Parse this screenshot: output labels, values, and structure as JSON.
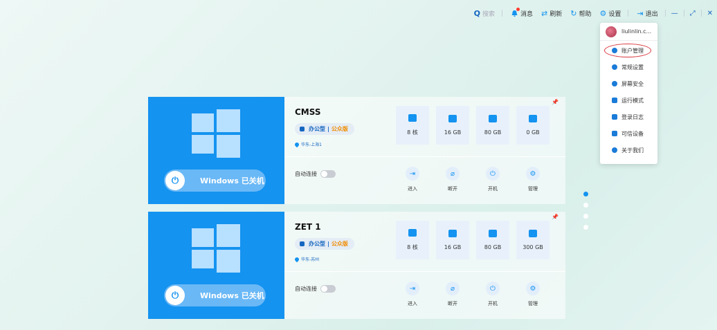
{
  "topbar": {
    "search_placeholder": "搜索",
    "items": [
      {
        "label": "消息",
        "icon": "bell-icon"
      },
      {
        "label": "刷新",
        "icon": "refresh-icon"
      },
      {
        "label": "帮助",
        "icon": "headset-icon"
      },
      {
        "label": "设置",
        "icon": "gear-icon"
      },
      {
        "label": "退出",
        "icon": "logout-icon"
      }
    ],
    "window_controls": [
      "—",
      "⤢",
      "✕"
    ]
  },
  "menu": {
    "username": "liulinlin.c...",
    "items": [
      {
        "label": "账户管理",
        "icon": "user-icon",
        "highlighted": true
      },
      {
        "label": "常规设置",
        "icon": "settings-icon"
      },
      {
        "label": "屏幕安全",
        "icon": "shield-icon"
      },
      {
        "label": "运行模式",
        "icon": "mode-icon"
      },
      {
        "label": "登录日志",
        "icon": "log-icon"
      },
      {
        "label": "可信设备",
        "icon": "monitor-icon"
      },
      {
        "label": "关于我们",
        "icon": "info-icon"
      }
    ]
  },
  "desktops": [
    {
      "name": "CMSS",
      "tag_type": "办公型",
      "tag_sep": "|",
      "tag_edition": "公众版",
      "region": "华东-上海1",
      "os_label": "Windows  已关机",
      "specs": [
        "8 核",
        "16 GB",
        "80 GB",
        "0 GB"
      ],
      "auto_connect_label": "自动连接",
      "auto_connect": false,
      "actions": [
        "进入",
        "断开",
        "开机",
        "管理"
      ]
    },
    {
      "name": "ZET 1",
      "tag_type": "办公型",
      "tag_sep": "|",
      "tag_edition": "公众版",
      "region": "华东-苏州",
      "os_label": "Windows  已关机",
      "specs": [
        "8 核",
        "16 GB",
        "80 GB",
        "300 GB"
      ],
      "auto_connect_label": "自动连接",
      "auto_connect": false,
      "actions": [
        "进入",
        "断开",
        "开机",
        "管理"
      ]
    }
  ],
  "pager": {
    "count": 4,
    "active": 0
  },
  "colors": {
    "accent": "#1493f0",
    "edition": "#f08c00",
    "highlight_ring": "#d9363e"
  }
}
